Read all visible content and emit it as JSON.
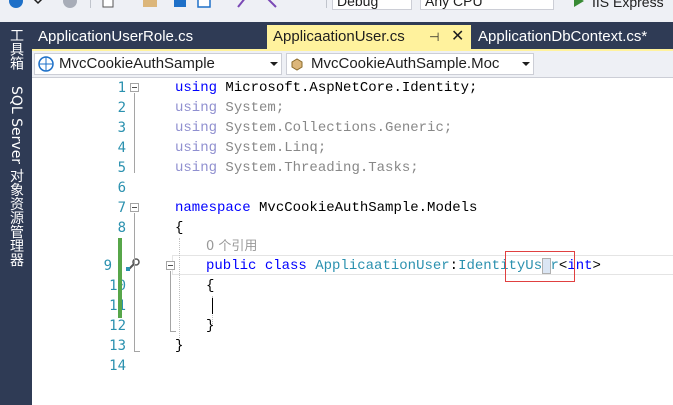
{
  "toolbar": {
    "config_value": "Debug",
    "platform_value": "Any CPU",
    "run_target_label": "IIS Express"
  },
  "side_panels": [
    {
      "label": "工具箱"
    },
    {
      "label": "SQL Server 对象资源管理器"
    }
  ],
  "tabs": [
    {
      "label": "ApplicationUserRole.cs",
      "active": false
    },
    {
      "label": "ApplicaationUser.cs",
      "active": true,
      "pin": "⊣",
      "close": "✕"
    },
    {
      "label": "ApplicationDbContext.cs*",
      "active": false
    }
  ],
  "nav": {
    "project": "MvcCookieAuthSample",
    "type": "MvcCookieAuthSample.Moc"
  },
  "editor": {
    "line_numbers": [
      "1",
      "2",
      "3",
      "4",
      "5",
      "6",
      "7",
      "8",
      "",
      "9",
      "10",
      "11",
      "12",
      "13",
      "14"
    ],
    "lines": {
      "l1": {
        "kw": "using",
        "rest": " Microsoft.AspNetCore.Identity;"
      },
      "l2": {
        "kw": "using",
        "rest": " System;"
      },
      "l3": {
        "kw": "using",
        "rest": " System.Collections.Generic;"
      },
      "l4": {
        "kw": "using",
        "rest": " System.Linq;"
      },
      "l5": {
        "kw": "using",
        "rest": " System.Threading.Tasks;"
      },
      "l7": {
        "kw": "namespace",
        "rest": " MvcCookieAuthSample.Models"
      },
      "l8": {
        "text": "{"
      },
      "codelens": "0 个引用",
      "l9": {
        "kw1": "public",
        "kw2": "class",
        "class_name": "ApplicaationUser",
        "colon": ":",
        "base": "IdentityUser",
        "lt": "<",
        "generic": "int",
        "gt": ">"
      },
      "l10": {
        "text": "{"
      },
      "l12": {
        "text": "}"
      },
      "l13": {
        "text": "}"
      }
    }
  },
  "colors": {
    "tab_active": "#fff29d",
    "chrome_dark": "#2f3b55",
    "keyword": "#0000ff",
    "type": "#2b91af",
    "change_marker": "#57a64a",
    "highlight_rect": "#e04040"
  }
}
